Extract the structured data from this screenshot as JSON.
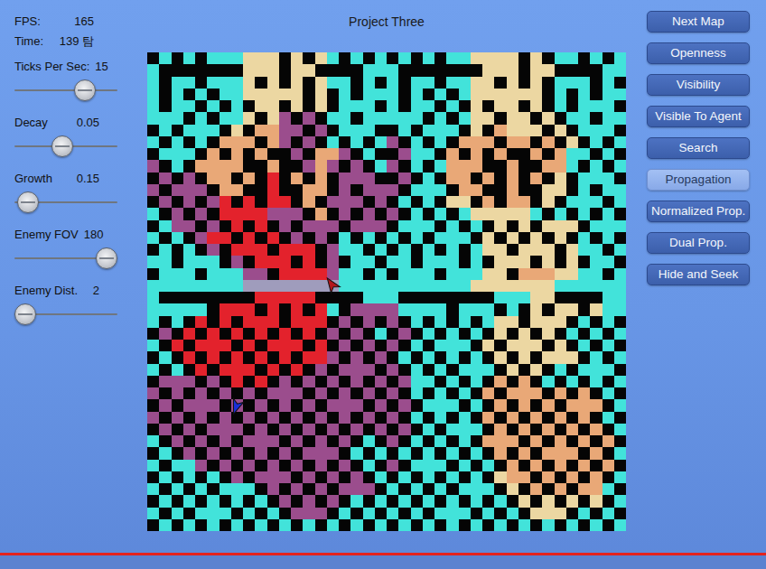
{
  "window": {
    "title": "Project Three"
  },
  "stats": [
    {
      "label": "FPS:",
      "value": "165"
    },
    {
      "label": "Time:",
      "value": "139 탐"
    }
  ],
  "sliders": [
    {
      "label": "Ticks Per Sec:",
      "value": "15",
      "level": 0.73
    },
    {
      "label": "Decay",
      "value": "0.05",
      "level": 0.46
    },
    {
      "label": "Growth",
      "value": "0.15",
      "level": 0.03
    },
    {
      "label": "Enemy FOV",
      "value": "180",
      "level": 1.0
    },
    {
      "label": "Enemy Dist.",
      "value": "2",
      "level": 0.0
    }
  ],
  "buttons": [
    {
      "label": "Next Map",
      "selected": false
    },
    {
      "label": "Openness",
      "selected": false
    },
    {
      "label": "Visibility",
      "selected": false
    },
    {
      "label": "Visible To Agent",
      "selected": false
    },
    {
      "label": "Search",
      "selected": false
    },
    {
      "label": "Propagation",
      "selected": true
    },
    {
      "label": "Normalized Prop.",
      "selected": false
    },
    {
      "label": "Dual Prop.",
      "selected": false
    },
    {
      "label": "Hide and Seek",
      "selected": false
    }
  ],
  "map": {
    "rows": [
      "#.#.#...yyy#y#y.#.#.#.#.#..yyyy#y#..#.#.",
      ".#######yyy#yy####...#######yyy#yy####..",
      ".#..#...y#y#y#y..#.#.#..#..yy#y#y#...#.#",
      ".#.#.#..yyyyy#y#.#...#.#.#.yyyyyy#.#.#..",
      ".#..#.#.#yy#y#y#...#.#..#.#y#yy#y#.#...#",
      "...#.#..y#yp#p#..#.....#.#.yy#yy#y#..#..",
      "#.#...#y#oopp#p#...##.#...#y#oyyy#y#...#",
      ".#.#.#ooo#op#p#.#.#.p#.#.#ooo#oo#o#y#.#.",
      "#...#o#o#o##p#oop#.##p..#o#o#o##o#o..#.#",
      "p#.#oooo##o##pop#p#.p#.#.ooo##o##oo.#.#.",
      "#p#p#oo#o#r#o#o#ppp##p#.#oo#o#o#o#y#...#",
      "p#ppp#oo##r##oo#p#ppp#...#oo##o##yy#.#..",
      "#p#p#pr#r#rr#o#ppp#p#.#.#yy#o#oo#y#...#.",
      ".#p#p#rrrrppp#o#p#p#p#.#.#.yyyyy.#.#.#.#",
      "#.pp#p#r#r#p#ppp#ppp#...#.#.#y#y#yyy#...",
      ".#.#prr#r#r#p#p#.#.#.#.#...#y#y#y#y#.#.#",
      "#.#.#p#rrr#rrr#p..#.#.#.#.#.yy#yyy#y..#.",
      "..#...#p#rrr#r#p#..#..#...#.#yyy#y#y#..#",
      "#...#...pp#rrrrp..#.#...#...yy#oooyy..#.",
      "........gggggggg...........yyyyyyy......",
      ".########rrrrr####...########...yy####..",
      ".....#rrr#r#r#r.#pppp....#...#.#y#yy#y..",
      ".#.#r#r#rrr#rrr#p#p#p#.#.#.#.yy#yyy#.#.#",
      "#p#r#r#r#r#r#r#p#p#.#p#.#.#.#y#y#y#.#.#.",
      ".#r#rrr#r#rrr#r#p#p#p#.#...#y#yyy#y#.#.#",
      "#.#r#r#r#r#r#rrp#p#p#.#.#.#.#y#y#yyy#.#.",
      ".#.#r#rrr#r#r#p#ppp#p#.#.#...#y#y#.#...#",
      "#ppp#p#r#r#p#p#p#p#p#p..#.#.#o#o#.#.#.#.",
      "p#p#p#p#p#ppp#p#p#p#p#.#.#.#o#ooo#o#o#.#",
      "#p#ppp#p#p#p#p#ppp#p#p#...#.#o#o#o#ooo#.",
      "p#p#p#p#p#p#p#p#p#p#p#.#.#.#o#o#o#o#o#.#",
      "#p#p#ppp#p#p#p#p#p#p#p#.#...#o#o#o#o#o#.",
      ".#p#p#p#ppp#p#p#p#.#p#.#.#.#ooo#o#o#o#o#",
      "#.#p#p#p#p#p#ppp#.#.#.#.#.#.#o#o#ooo#o#.",
      ".#..p#p#p#p#p#p#p#.#p#...#.#.#o#o#o#o#o#",
      "#.#.#.#p#ppp#p#p#p#.#.#.#.#.#yoo#o#o#o#.",
      ".#.#.#...#p#p#p#ppp#.#.#.#...#y#o#o#oo.#",
      "#.#.#.#.#.#p#p#p#.#.#.#.#.#.#.#y#y#y#y#.",
      ".#.#...#.#.#ppp#.#.#.#.#...#.#.#yyy#.#.#",
      "#.#.#.#.#.#.#.#.#.#.#.#.#.#.#.#.#.#.#.#."
    ],
    "agents": [
      {
        "name": "enemy",
        "row": 19,
        "col": 15,
        "heading": -35,
        "color": "#b3161c"
      },
      {
        "name": "player",
        "row": 29,
        "col": 7,
        "heading": 200,
        "color": "#1a2fd6"
      }
    ]
  }
}
